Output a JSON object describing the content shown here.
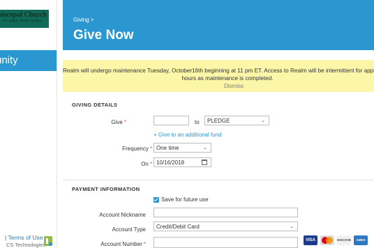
{
  "sidebar": {
    "logo_line1": "piscopal Church",
    "logo_line2": "in Cashiers, North Carolina",
    "active_item": "unity",
    "footer_terms": "Terms of Use",
    "footer_separator": "|",
    "footer_company": "CS Technologies"
  },
  "header": {
    "breadcrumb": "Giving >",
    "title": "Give Now"
  },
  "banner": {
    "line1": "Realm will undergo maintenance Tuesday, October16th beginning at 11 pm ET. Access to Realm will be intermittent for appro",
    "line2": "hours as maintenance is completed.",
    "dismiss": "Dismiss"
  },
  "giving_details": {
    "heading": "GIVING DETAILS",
    "give_label": "Give",
    "amount_value": "",
    "to_label": "to",
    "fund_selected": "PLEDGE",
    "add_fund_link": "+ Give to an additional fund",
    "frequency_label": "Frequency",
    "frequency_selected": "One time",
    "on_label": "On",
    "date_value": "10/16/2018",
    "required_marker": "*"
  },
  "payment": {
    "heading": "PAYMENT INFORMATION",
    "save_label": "Save for future use",
    "save_checked": true,
    "nickname_label": "Account Nickname",
    "nickname_value": "",
    "type_label": "Account Type",
    "type_selected": "Credit/Debit Card",
    "number_label": "Account Number",
    "number_value": "",
    "cards": [
      "VISA",
      "MasterCard",
      "DISCOVER",
      "AMEX"
    ]
  },
  "colors": {
    "accent": "#2a97d0",
    "banner": "#fbf6a8",
    "required": "#d9534f",
    "help_icon": "#8fbf3f"
  },
  "icons": {
    "select_chevron": "chevron-down-icon",
    "date_picker": "calendar-icon",
    "help": "help-icon"
  }
}
